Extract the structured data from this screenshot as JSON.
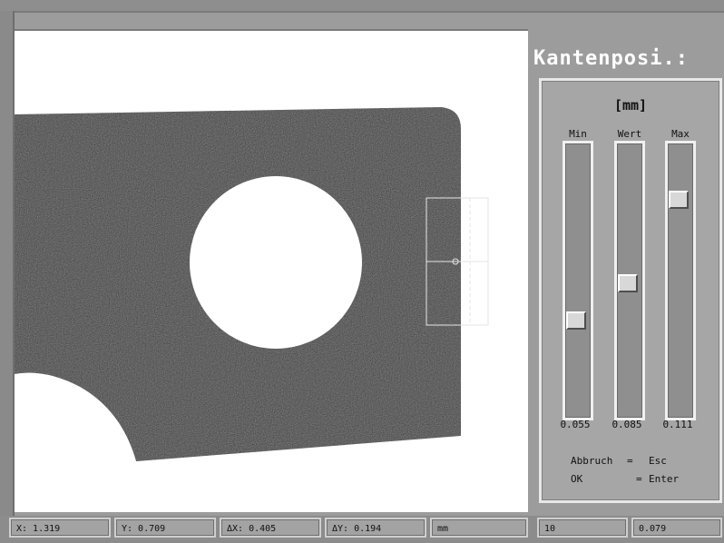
{
  "panel": {
    "title": "Kantenposi.:",
    "unit": "[mm]",
    "columns": [
      {
        "label": "Min",
        "value": "0.055",
        "level": 0.34
      },
      {
        "label": "Wert",
        "value": "0.085",
        "level": 0.49
      },
      {
        "label": "Max",
        "value": "0.111",
        "level": 0.82
      }
    ],
    "hints": {
      "cancel_label": "Abbruch",
      "cancel_eq": "=",
      "cancel_key": "Esc",
      "ok_label": "OK",
      "ok_eq": "=",
      "ok_key": "Enter"
    }
  },
  "status": {
    "x": "X: 1.319",
    "y": "Y: 0.709",
    "dx": "ΔX: 0.405",
    "dy": "ΔY: 0.194",
    "unit": "mm",
    "count": "10",
    "value": "0.079"
  },
  "colors": {
    "workpiece": "#3e3e3e",
    "background": "#ffffff",
    "panel": "#a6a6a6"
  }
}
